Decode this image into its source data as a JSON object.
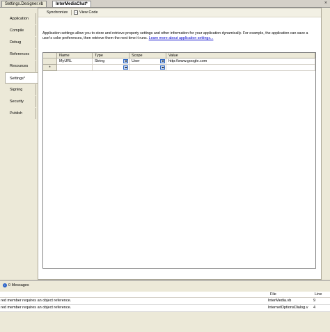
{
  "doc_tabs": [
    "Settings.Designer.vb",
    "InterMediaChat*"
  ],
  "tab_close_glyph": "×",
  "left_tabs": [
    "Application",
    "Compile",
    "Debug",
    "References",
    "Resources",
    "Settings*",
    "Signing",
    "Security",
    "Publish"
  ],
  "toolbar": {
    "synchronize": "Synchronize",
    "view_code": "View Code"
  },
  "description": {
    "text": "Application settings allow you to store and retrieve property settings and other information for your application dynamically. For example, the application can save a user's color preferences, then retrieve them the next time it runs.",
    "link": "Learn more about application settings..."
  },
  "grid": {
    "columns": [
      "Name",
      "Type",
      "Scope",
      "Value"
    ],
    "rows": [
      {
        "name": "MyURL",
        "type": "String",
        "scope": "User",
        "value": "http://www.google.com"
      }
    ],
    "new_row_marker": "*"
  },
  "error_list": {
    "messages_label": "0 Messages",
    "columns": {
      "file": "File",
      "line": "Line"
    },
    "rows": [
      {
        "text": "red member requires an object reference.",
        "file": "InterMedia.vb",
        "line": "9"
      },
      {
        "text": "red member requires an object reference.",
        "file": "InternetOptionsDialog.v",
        "line": "4"
      }
    ]
  },
  "colors": {
    "accent": "#316ac5",
    "panel": "#ece9d8",
    "link": "#0000cc"
  }
}
